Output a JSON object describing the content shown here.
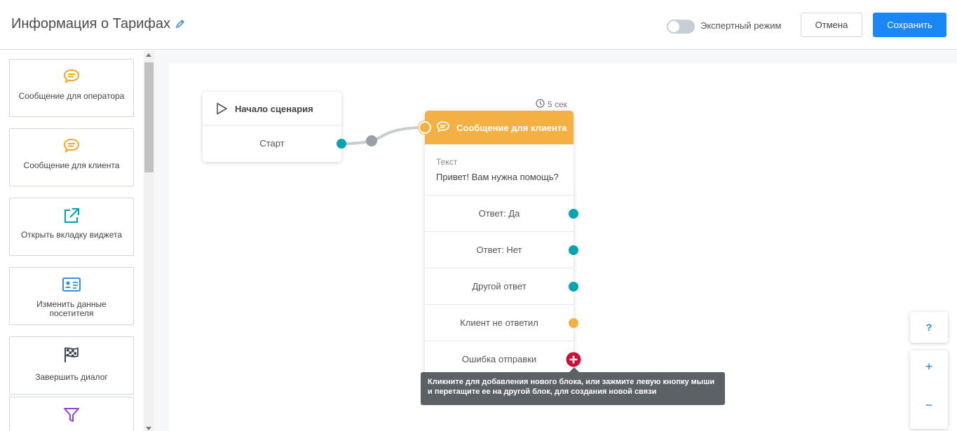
{
  "header": {
    "title": "Информация о Тарифах",
    "expert_mode_label": "Экспертный режим",
    "expert_mode_on": false,
    "cancel_label": "Отмена",
    "save_label": "Сохранить"
  },
  "palette": [
    {
      "label": "Сообщение для оператора",
      "icon": "chat-bubble-icon"
    },
    {
      "label": "Сообщение для клиента",
      "icon": "chat-bubble-icon"
    },
    {
      "label": "Открыть вкладку виджета",
      "icon": "external-link-icon"
    },
    {
      "label": "Изменить данные посетителя",
      "icon": "id-card-icon"
    },
    {
      "label": "Завершить диалог",
      "icon": "checkered-flag-icon"
    },
    {
      "label": "",
      "icon": "filter-icon"
    }
  ],
  "start_node": {
    "title": "Начало сценария",
    "row_label": "Старт"
  },
  "message_node": {
    "timer": "5 сек",
    "title": "Сообщение для клиента",
    "text_key": "Текст",
    "text_value": "Привет! Вам нужна помощь?",
    "options": [
      "Ответ: Да",
      "Ответ: Нет",
      "Другой ответ",
      "Клиент не ответил",
      "Ошибка отправки"
    ]
  },
  "tooltip": {
    "text": "Кликните для добавления нового блока, или зажмите левую кнопку мыши и перетащите ее на другой блок, для создания новой связи"
  },
  "controls": {
    "help": "?",
    "zoom_in": "+",
    "zoom_out": "−"
  },
  "colors": {
    "accent": "#1b87f5",
    "message_header": "#f5b043",
    "port_teal": "#0aa3b2",
    "port_amber": "#f5b043",
    "add_button": "#c8103a",
    "icon_amber": "#f5a623",
    "icon_teal": "#0aa3b2",
    "icon_blue": "#3a8dde",
    "icon_purple": "#9b3fc8"
  }
}
